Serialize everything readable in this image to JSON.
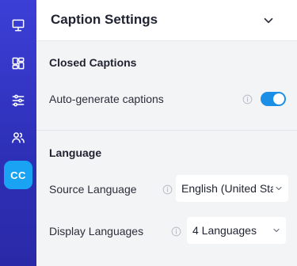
{
  "header": {
    "title": "Caption Settings"
  },
  "closed_captions": {
    "title": "Closed Captions",
    "auto_generate_label": "Auto-generate captions",
    "auto_generate_enabled": true
  },
  "language": {
    "title": "Language",
    "source_label": "Source Language",
    "source_value": "English (United States)",
    "display_label": "Display Languages",
    "display_value": "4 Languages"
  },
  "rail": {
    "items": [
      {
        "icon": "presentation-icon"
      },
      {
        "icon": "layout-dashboard-icon"
      },
      {
        "icon": "sliders-icon"
      },
      {
        "icon": "users-icon"
      },
      {
        "icon": "closed-captions-icon",
        "label": "CC",
        "active": true
      }
    ]
  },
  "colors": {
    "rail": "#3b3fd6",
    "active": "#1aa3f2",
    "toggle_on": "#1b8fe6"
  }
}
